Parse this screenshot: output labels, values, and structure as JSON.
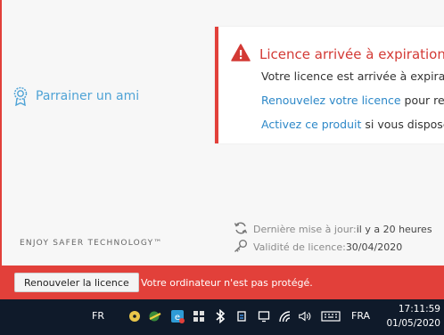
{
  "sidebar": {
    "refer_label": "Parrainer un ami"
  },
  "alert": {
    "title": "Licence arrivée à expiration",
    "line1": "Votre licence est arrivée à expiratio",
    "line2_link": "Renouvelez votre licence",
    "line2_rest": " pour reste",
    "line3_link": "Activez ce produit",
    "line3_rest": " si vous disposez"
  },
  "footer": {
    "tagline": "ENJOY SAFER TECHNOLOGY™",
    "update_label": "Dernière mise à jour: ",
    "update_value": "il y a 20 heures",
    "validity_label": "Validité de licence: ",
    "validity_value": "30/04/2020"
  },
  "status_bar": {
    "renew_button": "Renouveler la licence",
    "message": "Votre ordinateur n'est pas protégé."
  },
  "taskbar": {
    "input_lang": "FR",
    "keyboard_lang": "FRA",
    "time": "17:11:59",
    "date": "01/05/2020"
  },
  "colors": {
    "accent_red": "#e2403a",
    "link_blue": "#2d88c8",
    "taskbar": "#0f1a2a"
  }
}
